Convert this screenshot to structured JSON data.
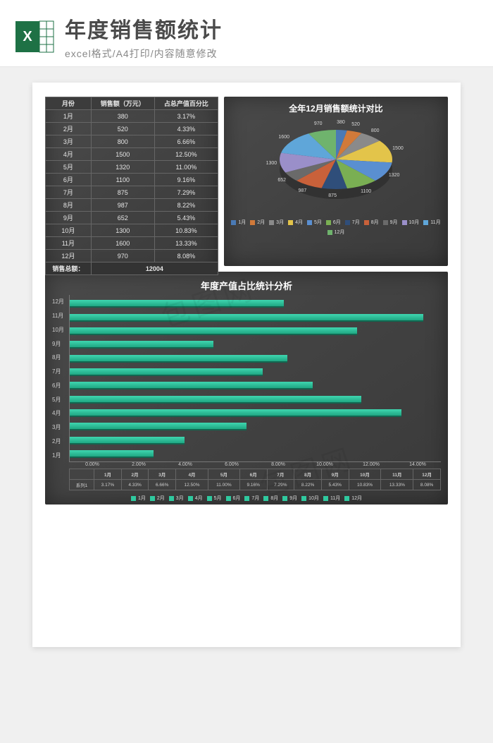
{
  "header": {
    "title": "年度销售额统计",
    "subtitle": "excel格式/A4打印/内容随意修改"
  },
  "table": {
    "headers": [
      "月份",
      "销售额（万元）",
      "占总产值百分比"
    ],
    "total_label": "销售总额：",
    "total_value": "12004",
    "rows": [
      {
        "m": "1月",
        "v": "380",
        "p": "3.17%"
      },
      {
        "m": "2月",
        "v": "520",
        "p": "4.33%"
      },
      {
        "m": "3月",
        "v": "800",
        "p": "6.66%"
      },
      {
        "m": "4月",
        "v": "1500",
        "p": "12.50%"
      },
      {
        "m": "5月",
        "v": "1320",
        "p": "11.00%"
      },
      {
        "m": "6月",
        "v": "1100",
        "p": "9.16%"
      },
      {
        "m": "7月",
        "v": "875",
        "p": "7.29%"
      },
      {
        "m": "8月",
        "v": "987",
        "p": "8.22%"
      },
      {
        "m": "9月",
        "v": "652",
        "p": "5.43%"
      },
      {
        "m": "10月",
        "v": "1300",
        "p": "10.83%"
      },
      {
        "m": "11月",
        "v": "1600",
        "p": "13.33%"
      },
      {
        "m": "12月",
        "v": "970",
        "p": "8.08%"
      }
    ]
  },
  "pie": {
    "title": "全年12月销售额统计对比",
    "colors": [
      "#4a7ab5",
      "#d17a3a",
      "#8a8a8a",
      "#e3c44a",
      "#5a8fd1",
      "#7aaf53",
      "#2f4e7a",
      "#c9613a",
      "#6a6a6a",
      "#9a8fc9",
      "#5fa6d9",
      "#6fb36d"
    ]
  },
  "bar": {
    "title": "年度产值占比统计分析",
    "series_label": "系列1",
    "xaxis": [
      "0.00%",
      "2.00%",
      "4.00%",
      "6.00%",
      "8.00%",
      "10.00%",
      "12.00%",
      "14.00%"
    ],
    "xmax": 14.0
  },
  "chart_data": [
    {
      "type": "pie",
      "title": "全年12月销售额统计对比",
      "categories": [
        "1月",
        "2月",
        "3月",
        "4月",
        "5月",
        "6月",
        "7月",
        "8月",
        "9月",
        "10月",
        "11月",
        "12月"
      ],
      "values": [
        380,
        520,
        800,
        1500,
        1320,
        1100,
        875,
        987,
        652,
        1300,
        1600,
        970
      ]
    },
    {
      "type": "bar",
      "orientation": "horizontal",
      "title": "年度产值占比统计分析",
      "categories": [
        "1月",
        "2月",
        "3月",
        "4月",
        "5月",
        "6月",
        "7月",
        "8月",
        "9月",
        "10月",
        "11月",
        "12月"
      ],
      "series": [
        {
          "name": "系列1",
          "values": [
            3.17,
            4.33,
            6.66,
            12.5,
            11.0,
            9.16,
            7.29,
            8.22,
            5.43,
            10.83,
            13.33,
            8.08
          ]
        }
      ],
      "xlabel": "",
      "ylabel": "",
      "xlim": [
        0,
        14
      ],
      "x_tick_labels": [
        "0.00%",
        "2.00%",
        "4.00%",
        "6.00%",
        "8.00%",
        "10.00%",
        "12.00%",
        "14.00%"
      ]
    },
    {
      "type": "table",
      "title": "月度销售额",
      "columns": [
        "月份",
        "销售额（万元）",
        "占总产值百分比"
      ],
      "rows": [
        [
          "1月",
          380,
          "3.17%"
        ],
        [
          "2月",
          520,
          "4.33%"
        ],
        [
          "3月",
          800,
          "6.66%"
        ],
        [
          "4月",
          1500,
          "12.50%"
        ],
        [
          "5月",
          1320,
          "11.00%"
        ],
        [
          "6月",
          1100,
          "9.16%"
        ],
        [
          "7月",
          875,
          "7.29%"
        ],
        [
          "8月",
          987,
          "8.22%"
        ],
        [
          "9月",
          652,
          "5.43%"
        ],
        [
          "10月",
          1300,
          "10.83%"
        ],
        [
          "11月",
          1600,
          "13.33%"
        ],
        [
          "12月",
          970,
          "8.08%"
        ]
      ],
      "footer": [
        "销售总额：",
        12004,
        ""
      ]
    }
  ]
}
